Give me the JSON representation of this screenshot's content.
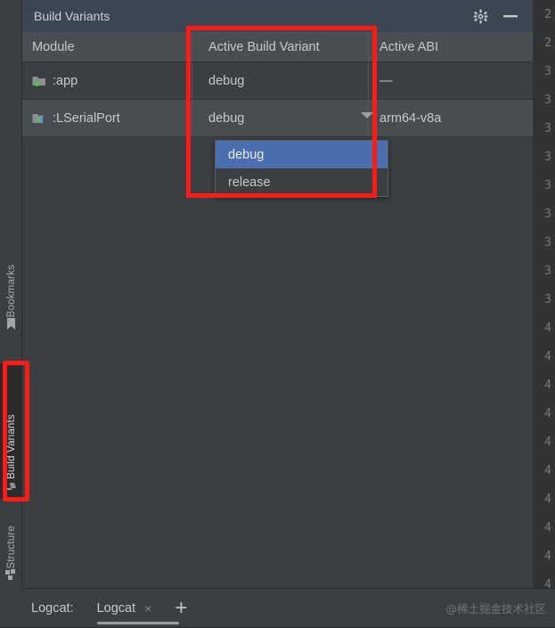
{
  "panel": {
    "title": "Build Variants",
    "gear_icon": "gear-icon",
    "minimize_icon": "minimize-icon"
  },
  "table": {
    "columns": [
      "Module",
      "Active Build Variant",
      "Active ABI"
    ],
    "rows": [
      {
        "module": ":app",
        "module_icon": "folder-module-icon",
        "variant": "debug",
        "abi": "—"
      },
      {
        "module": ":LSerialPort",
        "module_icon": "folder-library-icon",
        "variant": "debug",
        "abi": "arm64-v8a"
      }
    ]
  },
  "dropdown": {
    "open": true,
    "selected": "debug",
    "options": [
      "debug",
      "release"
    ],
    "arrow_icon": "chevron-down-icon",
    "highlight_color": "#4b6eaf"
  },
  "sidebar": {
    "items": [
      {
        "label": "Bookmarks",
        "icon": "bookmark-icon",
        "selected": false
      },
      {
        "label": "Build Variants",
        "icon": "build-variants-icon",
        "selected": true
      },
      {
        "label": "Structure",
        "icon": "structure-blocks-icon",
        "selected": false
      }
    ]
  },
  "bottom_bar": {
    "label": "Logcat:",
    "tab": "Logcat",
    "close_icon": "×",
    "add_icon": "+",
    "watermark": "@稀土掘金技术社区"
  },
  "gutter": {
    "line_numbers": [
      "2",
      "2",
      "3",
      "3",
      "3",
      "3",
      "3",
      "3",
      "3",
      "3",
      "3",
      "4",
      "4",
      "4",
      "4",
      "4",
      "4",
      "4",
      "4",
      "4",
      "4"
    ]
  },
  "annotation": {
    "color": "#fc1b15"
  }
}
